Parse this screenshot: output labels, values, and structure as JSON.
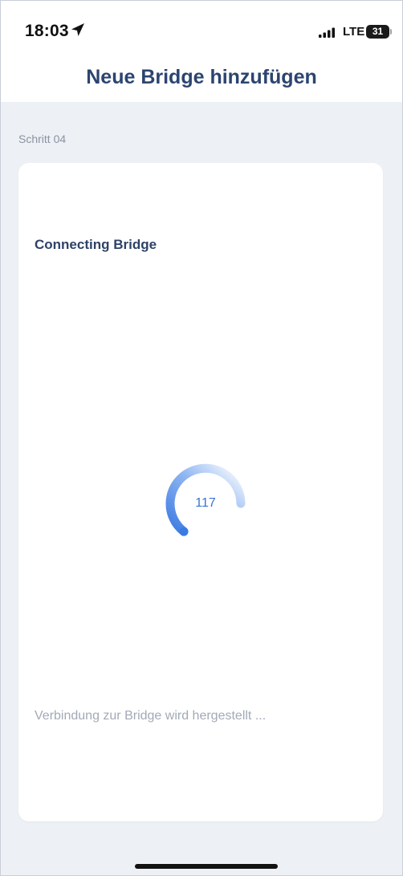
{
  "status_bar": {
    "time": "18:03",
    "location_icon": "location-arrow-icon",
    "signal_icon": "cellular-signal-icon",
    "network": "LTE",
    "battery_level": "31"
  },
  "header": {
    "title": "Neue Bridge hinzufügen"
  },
  "step": {
    "label": "Schritt 04"
  },
  "card": {
    "title": "Connecting Bridge",
    "countdown": "117",
    "status_text": "Verbindung zur Bridge wird hergestellt ..."
  },
  "colors": {
    "title": "#2c4470",
    "accent": "#3b73cf",
    "background": "#edf0f4",
    "card": "#ffffff",
    "muted": "#a2aab6"
  }
}
